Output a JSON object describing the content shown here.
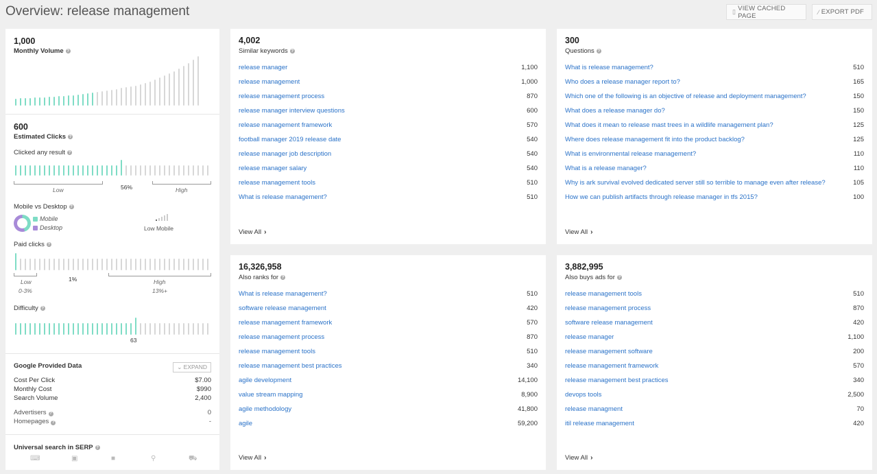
{
  "header": {
    "title": "Overview: release management",
    "view_cached_label": "VIEW CACHED PAGE",
    "export_pdf_label": "EXPORT PDF"
  },
  "left": {
    "monthly_volume": {
      "value": "1,000",
      "label": "Monthly Volume"
    },
    "estimated_clicks": {
      "value": "600",
      "label": "Estimated Clicks"
    },
    "clicked_any": {
      "label": "Clicked any result",
      "pct": "56%",
      "low": "Low",
      "high": "High"
    },
    "mobile_desktop": {
      "label": "Mobile vs Desktop",
      "mobile": "Mobile",
      "desktop": "Desktop",
      "summary": "Low Mobile"
    },
    "paid_clicks": {
      "label": "Paid clicks",
      "pct": "1%",
      "low": "Low",
      "low_range": "0-3%",
      "high": "High",
      "high_range": "13%+"
    },
    "difficulty": {
      "label": "Difficulty",
      "value": "63"
    },
    "google": {
      "title": "Google Provided Data",
      "expand_label": "EXPAND",
      "rows": [
        {
          "k": "Cost Per Click",
          "v": "$7.00"
        },
        {
          "k": "Monthly Cost",
          "v": "$990"
        },
        {
          "k": "Search Volume",
          "v": "2,400"
        }
      ],
      "advertisers": {
        "k": "Advertisers",
        "v": "0"
      },
      "homepages": {
        "k": "Homepages",
        "v": "-"
      }
    },
    "serp": {
      "label": "Universal search in SERP",
      "icons": [
        "keyboard-icon",
        "image-icon",
        "video-icon",
        "map-pin-icon",
        "cart-icon"
      ]
    }
  },
  "cards": {
    "similar": {
      "value": "4,002",
      "label": "Similar keywords",
      "view_all": "View All",
      "rows": [
        {
          "k": "release manager",
          "v": "1,100"
        },
        {
          "k": "release management",
          "v": "1,000"
        },
        {
          "k": "release management process",
          "v": "870"
        },
        {
          "k": "release manager interview questions",
          "v": "600"
        },
        {
          "k": "release management framework",
          "v": "570"
        },
        {
          "k": "football manager 2019 release date",
          "v": "540"
        },
        {
          "k": "release manager job description",
          "v": "540"
        },
        {
          "k": "release manager salary",
          "v": "540"
        },
        {
          "k": "release management tools",
          "v": "510"
        },
        {
          "k": "What is release management?",
          "v": "510"
        }
      ]
    },
    "questions": {
      "value": "300",
      "label": "Questions",
      "view_all": "View All",
      "rows": [
        {
          "k": "What is release management?",
          "v": "510"
        },
        {
          "k": "Who does a release manager report to?",
          "v": "165"
        },
        {
          "k": "Which one of the following is an objective of release and deployment management?",
          "v": "150"
        },
        {
          "k": "What does a release manager do?",
          "v": "150"
        },
        {
          "k": "What does it mean to release mast trees in a wildlife management plan?",
          "v": "125"
        },
        {
          "k": "Where does release management fit into the product backlog?",
          "v": "125"
        },
        {
          "k": "What is environmental release management?",
          "v": "110"
        },
        {
          "k": "What is a release manager?",
          "v": "110"
        },
        {
          "k": "Why is ark survival evolved dedicated server still so terrible to manage even after release?",
          "v": "105"
        },
        {
          "k": "How we can publish artifacts through release manager in tfs 2015?",
          "v": "100"
        }
      ]
    },
    "also_ranks": {
      "value": "16,326,958",
      "label": "Also ranks for",
      "view_all": "View All",
      "rows": [
        {
          "k": "What is release management?",
          "v": "510"
        },
        {
          "k": "software release management",
          "v": "420"
        },
        {
          "k": "release management framework",
          "v": "570"
        },
        {
          "k": "release management process",
          "v": "870"
        },
        {
          "k": "release management tools",
          "v": "510"
        },
        {
          "k": "release management best practices",
          "v": "340"
        },
        {
          "k": "agile development",
          "v": "14,100"
        },
        {
          "k": "value stream mapping",
          "v": "8,900"
        },
        {
          "k": "agile methodology",
          "v": "41,800"
        },
        {
          "k": "agile",
          "v": "59,200"
        }
      ]
    },
    "also_buys": {
      "value": "3,882,995",
      "label": "Also buys ads for",
      "view_all": "View All",
      "rows": [
        {
          "k": "release management tools",
          "v": "510"
        },
        {
          "k": "release management process",
          "v": "870"
        },
        {
          "k": "software release management",
          "v": "420"
        },
        {
          "k": "release manager",
          "v": "1,100"
        },
        {
          "k": "release management software",
          "v": "200"
        },
        {
          "k": "release management framework",
          "v": "570"
        },
        {
          "k": "release management best practices",
          "v": "340"
        },
        {
          "k": "devops tools",
          "v": "2,500"
        },
        {
          "k": "release managment",
          "v": "70"
        },
        {
          "k": "itil release management",
          "v": "420"
        }
      ]
    }
  },
  "colors": {
    "accent": "#7edcc5",
    "link": "#2a72c8",
    "desktop": "#a88bd8"
  },
  "meters": {
    "volume_history": [
      10,
      11,
      11,
      11,
      12,
      12,
      12,
      13,
      13,
      14,
      14,
      15,
      15,
      16,
      17,
      18,
      19,
      20,
      21,
      22,
      23,
      24,
      26,
      27,
      28,
      29,
      31,
      33,
      35,
      38,
      41,
      44,
      47,
      50,
      54,
      58,
      62,
      67,
      72
    ],
    "volume_highlight_count": 17,
    "clicked_any_fraction": 0.56,
    "mobile_fraction": 0.45,
    "paid_clicks_fraction": 0.01,
    "difficulty_score": 63
  }
}
